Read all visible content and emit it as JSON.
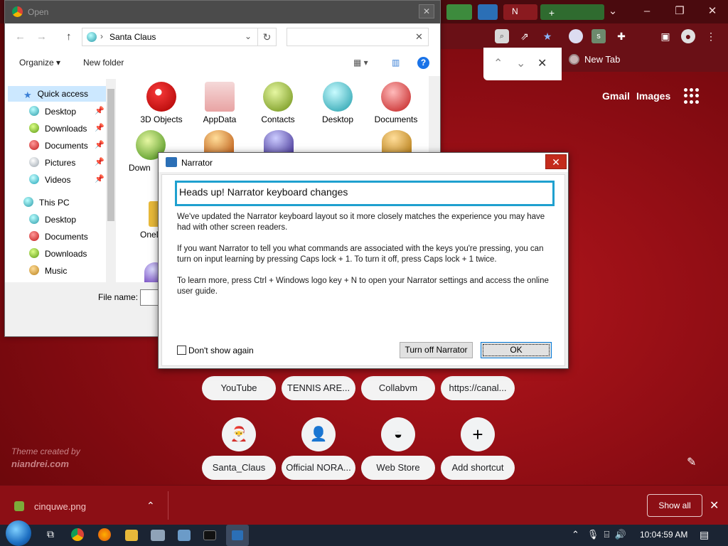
{
  "chrome": {
    "find_prev": "⌃",
    "find_next": "⌄",
    "find_close": "✕",
    "ntp_tab_title": "New Tab",
    "tab_partial": "N",
    "links": {
      "gmail": "Gmail",
      "images": "Images"
    },
    "shortcuts_row1": [
      "YouTube",
      "TENNIS ARE...",
      "Collabvm",
      "https://canal..."
    ],
    "shortcuts_row2": [
      "Santa_Claus",
      "Official NORA...",
      "Web Store",
      "Add shortcut"
    ],
    "add_symbol": "+",
    "theme_credit_line1": "Theme created by",
    "theme_credit_line2": "niandrei.com"
  },
  "download_bar": {
    "file_name": "cinquwe.png",
    "show_all_label": "Show all",
    "close": "✕",
    "chevron": "⌃"
  },
  "open_dialog": {
    "title": "Open",
    "path": "Santa Claus",
    "organize_label": "Organize ▾",
    "new_folder_label": "New folder",
    "nav_items": [
      {
        "label": "Quick access",
        "pinned": false
      },
      {
        "label": "Desktop",
        "pinned": true
      },
      {
        "label": "Downloads",
        "pinned": true
      },
      {
        "label": "Documents",
        "pinned": true
      },
      {
        "label": "Pictures",
        "pinned": true
      },
      {
        "label": "Videos",
        "pinned": true
      },
      {
        "label": "This PC",
        "pinned": false
      },
      {
        "label": "Desktop",
        "pinned": false
      },
      {
        "label": "Documents",
        "pinned": false
      },
      {
        "label": "Downloads",
        "pinned": false
      },
      {
        "label": "Music",
        "pinned": false
      }
    ],
    "files": [
      "3D Objects",
      "AppData",
      "Contacts",
      "Desktop",
      "Documents",
      "Down",
      "OneD"
    ],
    "file_name_label": "File name:"
  },
  "narrator": {
    "title": "Narrator",
    "heading": "Heads up! Narrator keyboard changes",
    "para1": "We've updated the Narrator keyboard layout so it more closely matches the experience you may have had with other screen readers.",
    "para2": "If you want Narrator to tell you what commands are associated with the keys you're pressing, you can turn on input learning by pressing Caps lock + 1. To turn it off, press Caps lock + 1 twice.",
    "para3": "To learn more, press Ctrl + Windows logo key + N to open your Narrator settings and access the online user guide.",
    "dont_show_again": "Don't show again",
    "turn_off_label": "Turn off Narrator",
    "ok_label": "OK",
    "close": "✕"
  },
  "taskbar": {
    "clock": "10:04:59 AM"
  },
  "colors": {
    "narrator_focus": "#1fa0cf",
    "close_red": "#c42b1c",
    "ntp_background": "#8f0d14"
  }
}
